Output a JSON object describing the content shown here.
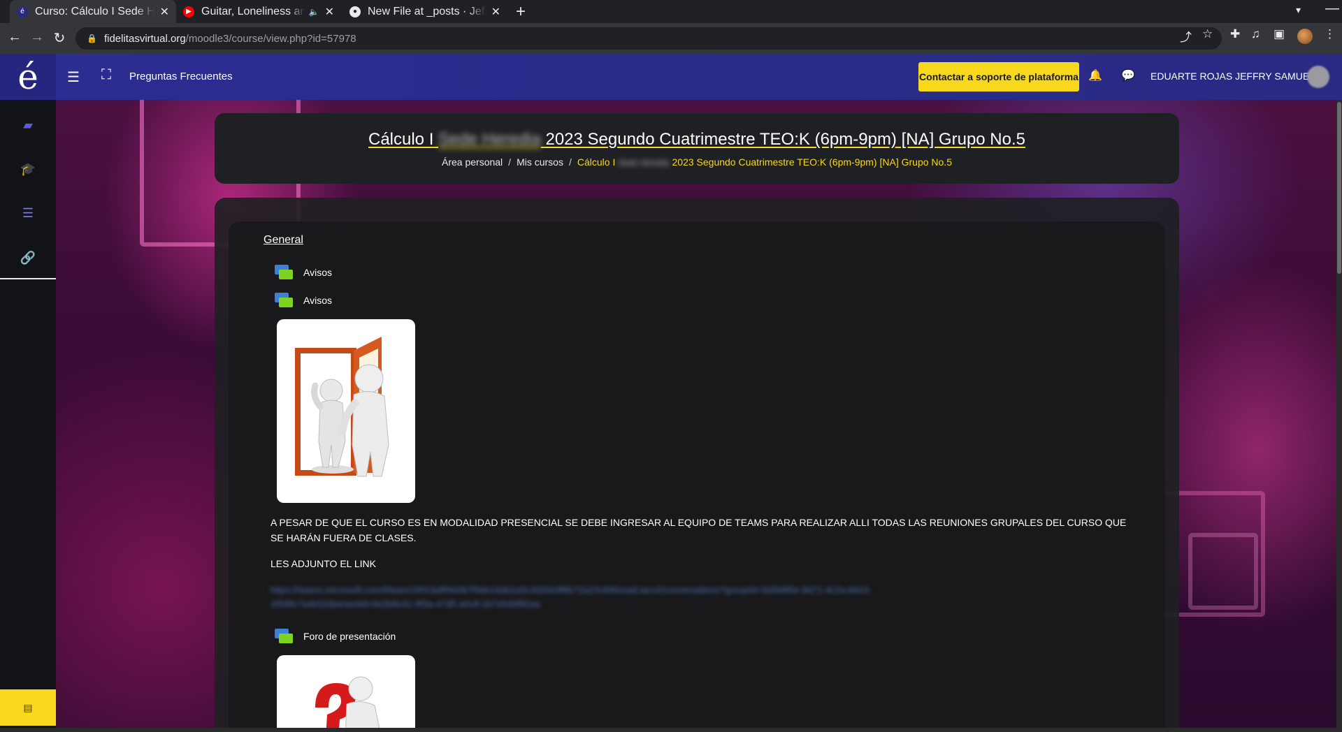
{
  "browser": {
    "tabs": [
      {
        "title": "Curso: Cálculo I Sede Heredia",
        "active": true
      },
      {
        "title": "Guitar, Loneliness and",
        "active": false
      },
      {
        "title": "New File at _posts · Jeffson",
        "active": false
      }
    ],
    "url_host": "fidelitasvirtual.org",
    "url_path": "/moodle3/course/view.php?id=57978"
  },
  "header": {
    "logo": "é",
    "faq_link": "Preguntas Frecuentes",
    "support_button": "Contactar a soporte de plataforma",
    "user_name": "EDUARTE ROJAS JEFFRY SAMUEL"
  },
  "course": {
    "title_prefix": "Cálculo I",
    "title_blurred": "Sede Heredia",
    "title_suffix": "2023 Segundo Cuatrimestre TEO:K (6pm-9pm) [NA] Grupo No.5",
    "breadcrumbs": {
      "home": "Área personal",
      "my_courses": "Mis cursos",
      "current_prefix": "Cálculo I",
      "current_blurred": "Sede Heredia",
      "current_suffix": "2023 Segundo Cuatrimestre TEO:K (6pm-9pm) [NA] Grupo No.5"
    }
  },
  "content": {
    "section_title": "General",
    "activities": [
      {
        "label": "Avisos"
      },
      {
        "label": "Avisos"
      },
      {
        "label": "Foro de presentación"
      }
    ],
    "paragraph1": "A PESAR DE  QUE EL CURSO ES EN MODALIDAD PRESENCIAL SE DEBE INGRESAR AL EQUIPO DE TEAMS PARA REALIZAR ALLI TODAS LAS REUNIONES GRUPALES DEL CURSO QUE SE HARÁN FUERA DE CLASES.",
    "paragraph2": "LES ADJUNTO EL LINK",
    "link_blurred": "https://teams.microsoft.com/l/team/19%3a8f4e0b7f9de14ab1a5c3d20e9f8b72a1%40thread.tacv2/conversations?groupId=3a5b9f0e-8d71-4c2a-b6e3-1f0d9c7a4e52&tenantId=6e2b8c41-9f3a-47d5-a0c8-1b7e5d3f92aa"
  },
  "colors": {
    "header_bg": "#2c2c92",
    "accent_yellow": "#f8d81c",
    "sidebar_bg": "#121316",
    "card_bg": "#1f2023"
  }
}
